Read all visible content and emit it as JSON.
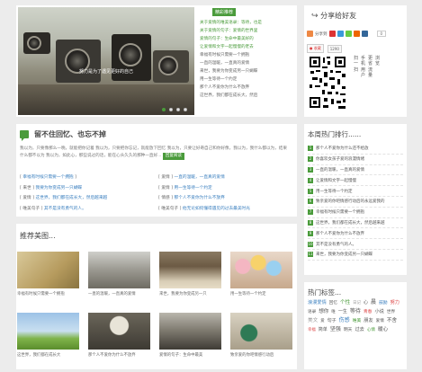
{
  "slider": {
    "caption": "努力是为了遇见更好的自己",
    "badge": "精彩推荐",
    "items": [
      "关于爱情的唯美语录：等待，也是",
      "关于爱情的句子：爱情的世界里",
      "爱情的句子：生命中最美好的",
      "让爱情和文字一起慢慢的老去",
      "幸福有时候只需要一个拥抱",
      "一直的温暖，一直真的爱情",
      "来世，我要为你变成另一只蝴蝶",
      "用一生等待一个约定",
      "那个人不爱你为什么不放弃",
      "这世界，我们都在成长大，然后"
    ],
    "dots": 4
  },
  "share": {
    "title": "分享给好友",
    "share_label": "分享到",
    "count": "0",
    "weibo_label": "收藏",
    "weibo_count": "1290",
    "qr_text_cols": [
      "扫一扫",
      "手机用户",
      "更省流量",
      "浏览"
    ]
  },
  "memory": {
    "title": "留不住回忆、也忘不掉",
    "desc": "我以为，只要像那么一晚，就能把你记着 我以为，只要把你忘记，就能放下回忆 我以为，只要让好奇自己和你好像，我以为，我什么都以为，结果什么都不以为 我以为，如此心，那些说过的话，能在心头久久的那种一直好...",
    "more": "回复阅读",
    "items": [
      {
        "cat": "幸福有时候只需要一个拥抱",
        "text": ""
      },
      {
        "cat": "爱情",
        "text": "一直的温暖，一直真的爱情"
      },
      {
        "cat": "来世",
        "text": "我要为你变成另一只蝴蝶"
      },
      {
        "cat": "爱情",
        "text": "用一生等待一个约定"
      },
      {
        "cat": "爱情",
        "text": "这世界，我们都在成长大，然后越来越"
      },
      {
        "cat": "情感",
        "text": "那个人不爱你为什么不放弃"
      },
      {
        "cat": "唯美句子",
        "text": "其不是没有勇气的人。"
      },
      {
        "cat": "唯美句子",
        "text": "他无论如何懂得遇见的过去最美时光"
      }
    ]
  },
  "hot": {
    "title": "本周热门排行......",
    "items": [
      "那个人不爱你为什么还不给放",
      "你喜欢女孩子爱的浪漫情绪",
      "一直的温暖，一直真的爱情",
      "让爱情和文字一起慢慢",
      "用一生等待一个约定",
      "致亲爱的你吧情感行动后的永远爱我的",
      "幸福有时候只需要一个拥抱",
      "这世界，我们都在成长大，然后越来越",
      "那个人不爱你为什么不放弃",
      "其不是没有勇气的人。",
      "来世，我要为你变成另一只蝴蝶"
    ]
  },
  "photos": {
    "title": "推荐美图...",
    "items": [
      "幸福有时候只需要一个拥抱",
      "一直的温暖，一直真的爱情",
      "来世，我要为你变成另一只",
      "用一生等待一个约定",
      "这世界，我们都在成长大",
      "那个人不爱你为什么不放弃",
      "爱情的句子：生命中最美",
      "致亲爱的你吧情感行动后"
    ]
  },
  "tags": {
    "title": "热门标签...",
    "items": [
      {
        "t": "浪漫爱情",
        "c": "#3a7fbf"
      },
      {
        "t": "回忆",
        "c": "#555"
      },
      {
        "t": "个性",
        "c": "#4a9b3b"
      },
      {
        "t": "日记",
        "c": "#999"
      },
      {
        "t": "心",
        "c": "#555"
      },
      {
        "t": "晨",
        "c": "#555"
      },
      {
        "t": "鼓励",
        "c": "#3a7fbf"
      },
      {
        "t": "努力",
        "c": "#d44"
      },
      {
        "t": "语录",
        "c": "#555"
      },
      {
        "t": "想你",
        "c": "#555"
      },
      {
        "t": "唯",
        "c": "#555"
      },
      {
        "t": "一生",
        "c": "#555"
      },
      {
        "t": "等待",
        "c": "#555"
      },
      {
        "t": "青春",
        "c": "#d44"
      },
      {
        "t": "小说",
        "c": "#555"
      },
      {
        "t": "世界",
        "c": "#555"
      },
      {
        "t": "美文",
        "c": "#999"
      },
      {
        "t": "爱",
        "c": "#555"
      },
      {
        "t": "句子",
        "c": "#555"
      },
      {
        "t": "伤感",
        "c": "#3a7fbf"
      },
      {
        "t": "唯美",
        "c": "#4a9b3b"
      },
      {
        "t": "朋友",
        "c": "#555"
      },
      {
        "t": "爱情",
        "c": "#555"
      },
      {
        "t": "不舍",
        "c": "#555"
      },
      {
        "t": "幸福",
        "c": "#d44"
      },
      {
        "t": "简单",
        "c": "#555"
      },
      {
        "t": "坚强",
        "c": "#555"
      },
      {
        "t": "明天",
        "c": "#555"
      },
      {
        "t": "过去",
        "c": "#555"
      },
      {
        "t": "心情",
        "c": "#4a9b3b"
      },
      {
        "t": "暖心",
        "c": "#555"
      }
    ]
  }
}
